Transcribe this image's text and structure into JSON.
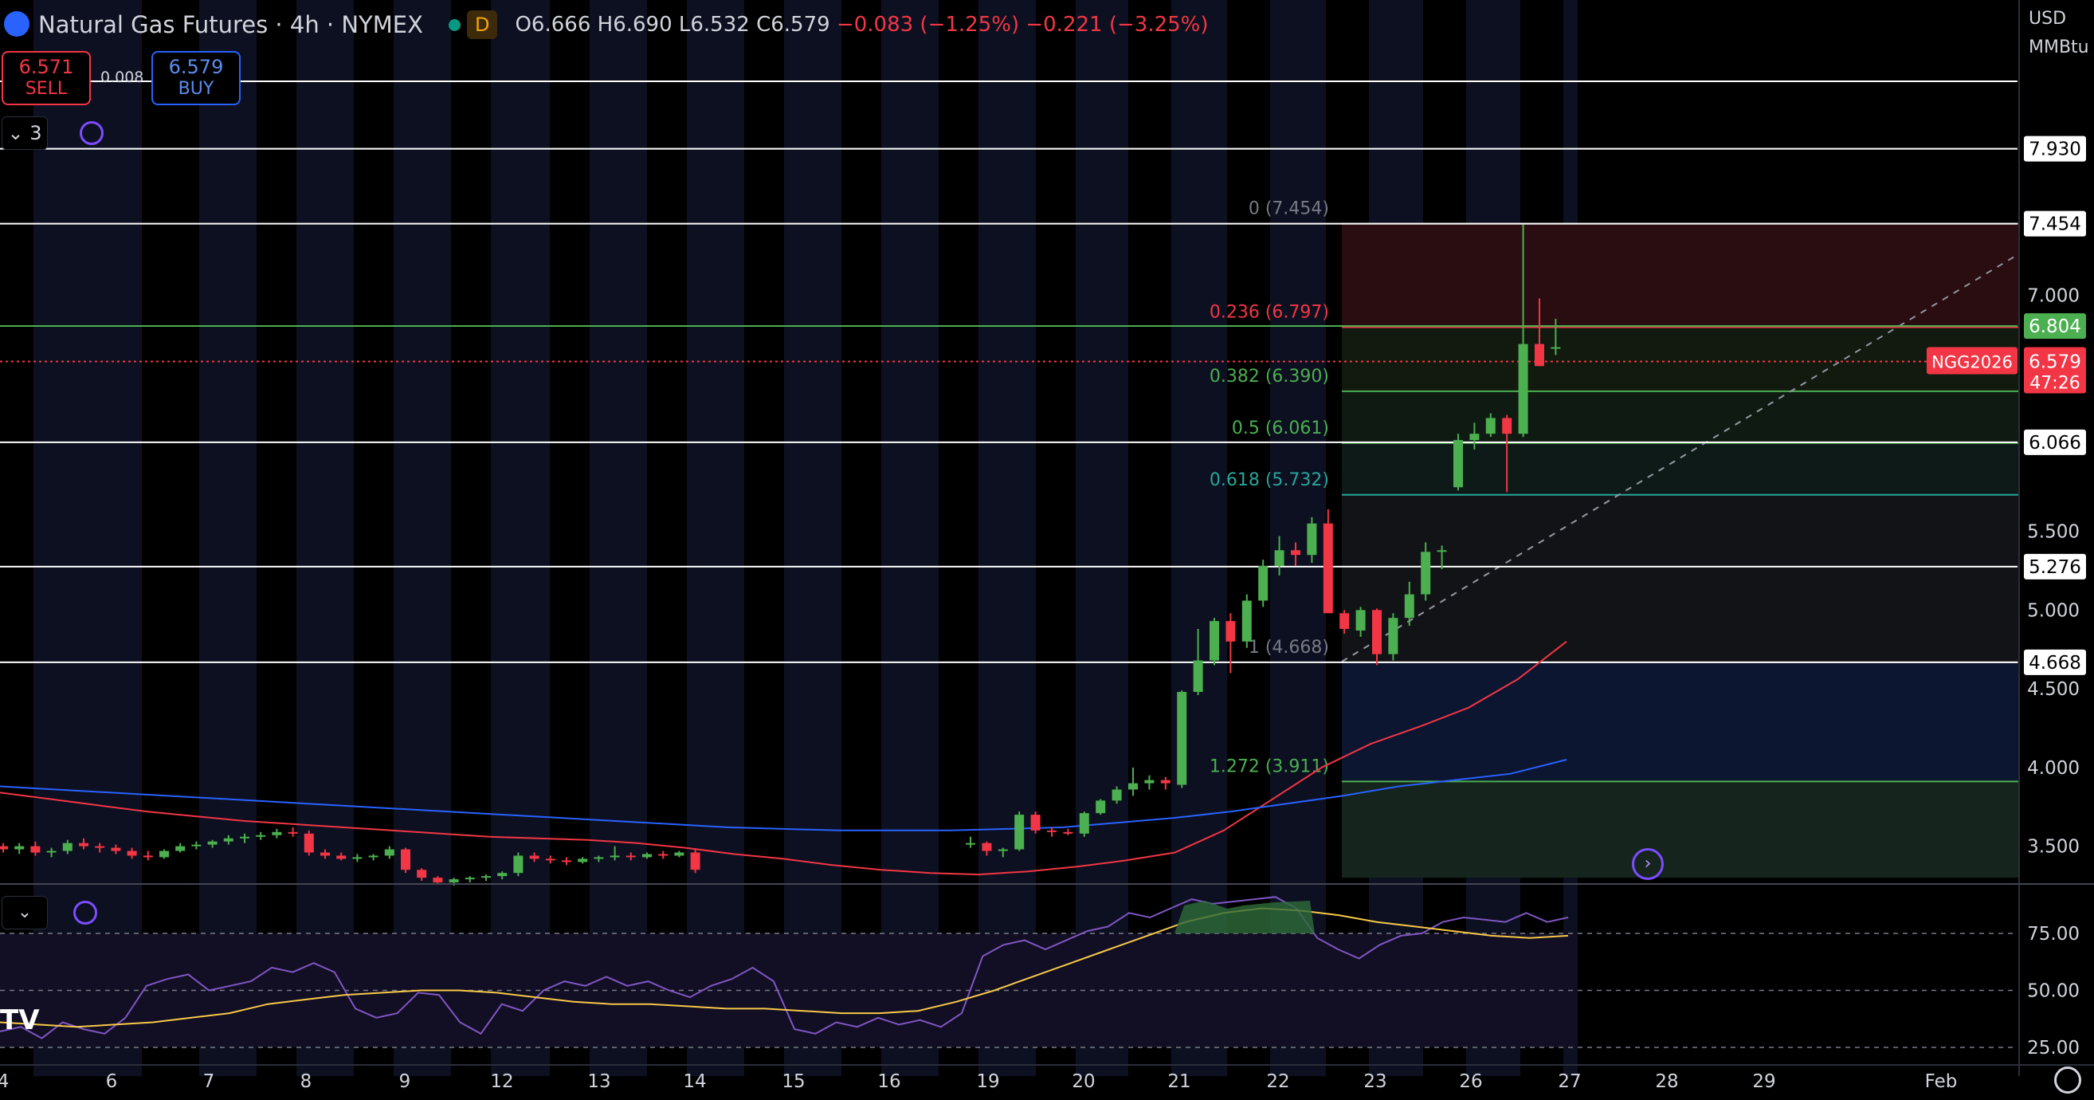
{
  "header": {
    "title": "Natural Gas Futures · 4h · NYMEX",
    "flag": "D",
    "open": "O6.666",
    "high": "H6.690",
    "low": "L6.532",
    "close": "C6.579",
    "change": "−0.083 (−1.25%)",
    "change2": "−0.221 (−3.25%)"
  },
  "trade": {
    "sell_price": "6.571",
    "sell_label": "SELL",
    "buy_price": "6.579",
    "buy_label": "BUY",
    "spread": "0.008"
  },
  "indicator_count": "3",
  "axis_header": {
    "currency": "USD",
    "unit": "MMBtu"
  },
  "colors": {
    "up": "#4caf50",
    "down": "#f23645",
    "ma_red": "#f23645",
    "ma_blue": "#2962ff",
    "rsi": "#7e57c2",
    "rsi_ma": "#f7c948",
    "fib_red": "#f23645",
    "fib_green": "#4caf50",
    "fib_teal": "#26a69a",
    "fib_blue": "#2962ff"
  },
  "chart_data": {
    "type": "candlestick",
    "symbol_label": "NGG2026",
    "last_price": "6.579",
    "countdown": "47:26",
    "y_ticks": [
      "7.000",
      "5.500",
      "5.000",
      "4.500",
      "4.000",
      "3.500"
    ],
    "x_ticks": [
      "4",
      "6",
      "7",
      "8",
      "9",
      "12",
      "13",
      "14",
      "15",
      "16",
      "19",
      "20",
      "21",
      "22",
      "23",
      "26",
      "27",
      "28",
      "29",
      "Feb"
    ],
    "horizontal_levels": [
      {
        "price": 7.93,
        "label": "7.930"
      },
      {
        "price": 7.454,
        "label": "7.454"
      },
      {
        "price": 6.804,
        "label": "6.804"
      },
      {
        "price": 6.066,
        "label": "6.066"
      },
      {
        "price": 5.276,
        "label": "5.276"
      },
      {
        "price": 4.668,
        "label": "4.668"
      }
    ],
    "fibonacci": [
      {
        "ratio": "0",
        "price": 7.454,
        "label": "0 (7.454)"
      },
      {
        "ratio": "0.236",
        "price": 6.797,
        "label": "0.236 (6.797)"
      },
      {
        "ratio": "0.382",
        "price": 6.39,
        "label": "0.382 (6.390)"
      },
      {
        "ratio": "0.5",
        "price": 6.061,
        "label": "0.5 (6.061)"
      },
      {
        "ratio": "0.618",
        "price": 5.732,
        "label": "0.618 (5.732)"
      },
      {
        "ratio": "1",
        "price": 4.668,
        "label": "1 (4.668)"
      },
      {
        "ratio": "1.272",
        "price": 3.911,
        "label": "1.272 (3.911)"
      }
    ],
    "candles_ohlc": [
      [
        3.5,
        3.52,
        3.46,
        3.48
      ],
      [
        3.48,
        3.52,
        3.45,
        3.5
      ],
      [
        3.5,
        3.53,
        3.44,
        3.46
      ],
      [
        3.46,
        3.49,
        3.43,
        3.47
      ],
      [
        3.47,
        3.54,
        3.45,
        3.52
      ],
      [
        3.52,
        3.55,
        3.48,
        3.5
      ],
      [
        3.5,
        3.52,
        3.46,
        3.49
      ],
      [
        3.49,
        3.51,
        3.45,
        3.47
      ],
      [
        3.47,
        3.49,
        3.42,
        3.44
      ],
      [
        3.44,
        3.47,
        3.41,
        3.43
      ],
      [
        3.43,
        3.48,
        3.42,
        3.47
      ],
      [
        3.47,
        3.52,
        3.46,
        3.5
      ],
      [
        3.5,
        3.53,
        3.48,
        3.51
      ],
      [
        3.51,
        3.54,
        3.49,
        3.53
      ],
      [
        3.53,
        3.57,
        3.51,
        3.55
      ],
      [
        3.55,
        3.58,
        3.52,
        3.56
      ],
      [
        3.56,
        3.59,
        3.54,
        3.57
      ],
      [
        3.57,
        3.61,
        3.55,
        3.59
      ],
      [
        3.59,
        3.62,
        3.56,
        3.58
      ],
      [
        3.58,
        3.6,
        3.44,
        3.46
      ],
      [
        3.46,
        3.48,
        3.42,
        3.44
      ],
      [
        3.44,
        3.46,
        3.41,
        3.42
      ],
      [
        3.42,
        3.45,
        3.4,
        3.43
      ],
      [
        3.43,
        3.45,
        3.41,
        3.44
      ],
      [
        3.44,
        3.5,
        3.42,
        3.48
      ],
      [
        3.48,
        3.49,
        3.33,
        3.35
      ],
      [
        3.35,
        3.36,
        3.28,
        3.3
      ],
      [
        3.3,
        3.31,
        3.26,
        3.27
      ],
      [
        3.27,
        3.3,
        3.25,
        3.29
      ],
      [
        3.29,
        3.31,
        3.27,
        3.3
      ],
      [
        3.3,
        3.32,
        3.28,
        3.31
      ],
      [
        3.31,
        3.34,
        3.29,
        3.33
      ],
      [
        3.33,
        3.46,
        3.31,
        3.44
      ],
      [
        3.44,
        3.46,
        3.4,
        3.42
      ],
      [
        3.42,
        3.44,
        3.39,
        3.41
      ],
      [
        3.41,
        3.43,
        3.38,
        3.4
      ],
      [
        3.4,
        3.43,
        3.39,
        3.42
      ],
      [
        3.42,
        3.44,
        3.4,
        3.43
      ],
      [
        3.43,
        3.5,
        3.41,
        3.44
      ],
      [
        3.44,
        3.46,
        3.41,
        3.43
      ],
      [
        3.43,
        3.46,
        3.42,
        3.45
      ],
      [
        3.45,
        3.47,
        3.42,
        3.44
      ],
      [
        3.44,
        3.47,
        3.43,
        3.46
      ],
      [
        3.46,
        3.48,
        3.33,
        3.35
      ],
      [
        3.52,
        3.56,
        3.49,
        3.52
      ],
      [
        3.52,
        3.53,
        3.44,
        3.47
      ],
      [
        3.47,
        3.49,
        3.43,
        3.48
      ],
      [
        3.48,
        3.72,
        3.47,
        3.7
      ],
      [
        3.7,
        3.72,
        3.58,
        3.6
      ],
      [
        3.6,
        3.62,
        3.56,
        3.59
      ],
      [
        3.59,
        3.61,
        3.57,
        3.58
      ],
      [
        3.58,
        3.72,
        3.56,
        3.71
      ],
      [
        3.71,
        3.8,
        3.7,
        3.79
      ],
      [
        3.79,
        3.88,
        3.77,
        3.86
      ],
      [
        3.86,
        4.0,
        3.82,
        3.9
      ],
      [
        3.9,
        3.95,
        3.86,
        3.92
      ],
      [
        3.92,
        3.94,
        3.86,
        3.9
      ],
      [
        3.89,
        4.49,
        3.87,
        4.48
      ],
      [
        4.48,
        4.88,
        4.46,
        4.68
      ],
      [
        4.68,
        4.95,
        4.65,
        4.93
      ],
      [
        4.93,
        4.98,
        4.6,
        4.8
      ],
      [
        4.8,
        5.1,
        4.76,
        5.06
      ],
      [
        5.06,
        5.32,
        5.02,
        5.28
      ],
      [
        5.28,
        5.47,
        5.22,
        5.38
      ],
      [
        5.38,
        5.43,
        5.28,
        5.35
      ],
      [
        5.35,
        5.59,
        5.3,
        5.55
      ],
      [
        5.55,
        5.64,
        5.02,
        4.98
      ],
      [
        4.98,
        5.0,
        4.85,
        4.88
      ],
      [
        4.87,
        5.02,
        4.83,
        5.0
      ],
      [
        5.0,
        5.01,
        4.65,
        4.72
      ],
      [
        4.72,
        4.98,
        4.68,
        4.95
      ],
      [
        4.95,
        5.18,
        4.9,
        5.1
      ],
      [
        5.1,
        5.43,
        5.06,
        5.37
      ],
      [
        5.37,
        5.41,
        5.26,
        5.38
      ],
      [
        5.78,
        6.12,
        5.76,
        6.08
      ],
      [
        6.08,
        6.19,
        6.02,
        6.12
      ],
      [
        6.12,
        6.25,
        6.1,
        6.22
      ],
      [
        6.22,
        6.24,
        5.75,
        6.12
      ],
      [
        6.12,
        7.45,
        6.1,
        6.69
      ],
      [
        6.69,
        6.98,
        6.55,
        6.55
      ],
      [
        6.66,
        6.85,
        6.62,
        6.67
      ],
      [
        6.666,
        6.69,
        6.532,
        6.579
      ]
    ],
    "ma_red": [
      3.84,
      3.8,
      3.76,
      3.72,
      3.69,
      3.66,
      3.64,
      3.62,
      3.6,
      3.58,
      3.56,
      3.55,
      3.54,
      3.52,
      3.49,
      3.45,
      3.42,
      3.38,
      3.35,
      3.33,
      3.32,
      3.34,
      3.37,
      3.41,
      3.46,
      3.6,
      3.8,
      4.0,
      4.15,
      4.26,
      4.38,
      4.56,
      4.8
    ],
    "ma_blue": [
      3.88,
      3.86,
      3.84,
      3.82,
      3.8,
      3.78,
      3.76,
      3.74,
      3.72,
      3.7,
      3.68,
      3.66,
      3.64,
      3.62,
      3.61,
      3.6,
      3.6,
      3.6,
      3.61,
      3.62,
      3.65,
      3.68,
      3.72,
      3.77,
      3.82,
      3.88,
      3.92,
      3.96,
      4.05
    ],
    "rsi": {
      "levels": [
        "75.00",
        "50.00",
        "25.00"
      ],
      "values": [
        32,
        34,
        29,
        36,
        33,
        31,
        38,
        52,
        55,
        57,
        50,
        52,
        54,
        60,
        58,
        62,
        58,
        42,
        38,
        40,
        49,
        48,
        36,
        31,
        44,
        41,
        50,
        54,
        52,
        56,
        52,
        54,
        50,
        47,
        52,
        55,
        60,
        54,
        33,
        31,
        36,
        34,
        38,
        35,
        37,
        34,
        40,
        65,
        70,
        72,
        68,
        72,
        76,
        78,
        84,
        82,
        86,
        90,
        88,
        89,
        90,
        91,
        86,
        73,
        68,
        64,
        70,
        74,
        75,
        80,
        82,
        81,
        80,
        84,
        80,
        82
      ],
      "ma_values": [
        36,
        35,
        34,
        35,
        36,
        38,
        40,
        44,
        46,
        48,
        49,
        50,
        50,
        49,
        47,
        45,
        44,
        44,
        43,
        42,
        42,
        41,
        40,
        40,
        41,
        45,
        50,
        56,
        62,
        68,
        74,
        80,
        84,
        86,
        85,
        83,
        80,
        78,
        76,
        74,
        73,
        74
      ]
    }
  }
}
